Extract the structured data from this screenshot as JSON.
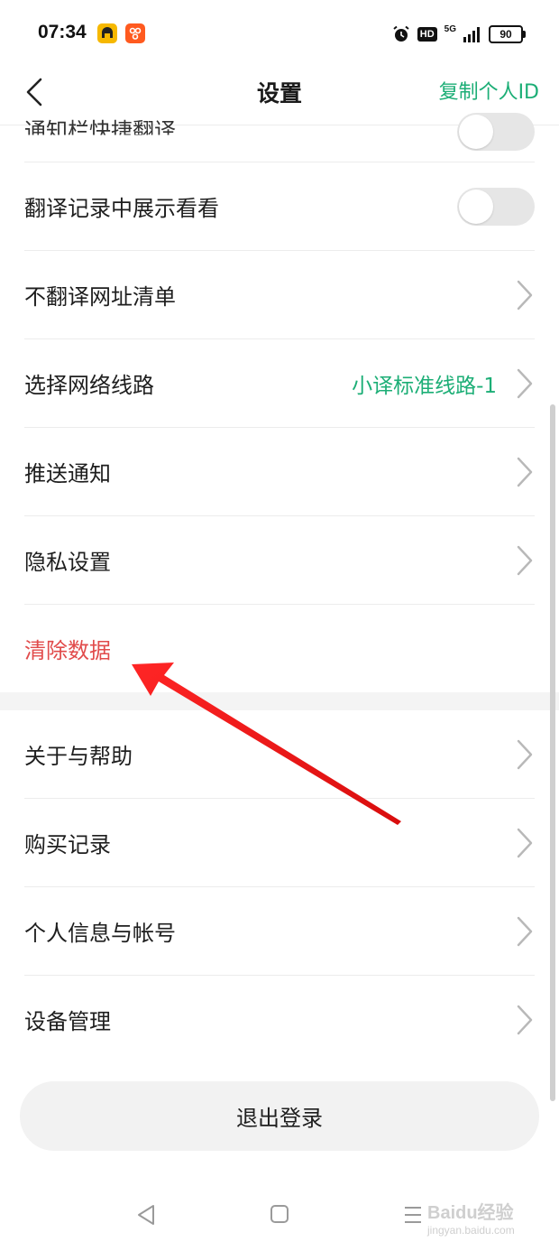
{
  "status_bar": {
    "time": "07:34",
    "hd_label": "HD",
    "network_label": "5G",
    "battery_level": "90",
    "icons": [
      "app-icon",
      "app-icon",
      "alarm-icon",
      "hd-icon",
      "signal-icon",
      "battery-icon"
    ]
  },
  "header": {
    "title": "设置",
    "action_label": "复制个人ID",
    "accent_color": "#1cae76"
  },
  "settings": {
    "partial_item": "通知栏快捷翻译",
    "items": [
      {
        "label": "翻译记录中展示看看",
        "control": "toggle",
        "on": false
      },
      {
        "label": "不翻译网址清单",
        "control": "chevron"
      },
      {
        "label": "选择网络线路",
        "value": "小译标准线路-1",
        "control": "chevron"
      },
      {
        "label": "推送通知",
        "control": "chevron"
      },
      {
        "label": "隐私设置",
        "control": "chevron"
      },
      {
        "label": "清除数据",
        "control": "none",
        "color": "#e14b4b"
      }
    ],
    "items2": [
      {
        "label": "关于与帮助",
        "control": "chevron"
      },
      {
        "label": "购买记录",
        "control": "chevron"
      },
      {
        "label": "个人信息与帐号",
        "control": "chevron"
      },
      {
        "label": "设备管理",
        "control": "chevron"
      }
    ]
  },
  "logout_label": "退出登录",
  "watermark": {
    "line1": "Baidu经验",
    "line2": "jingyan.baidu.com"
  }
}
